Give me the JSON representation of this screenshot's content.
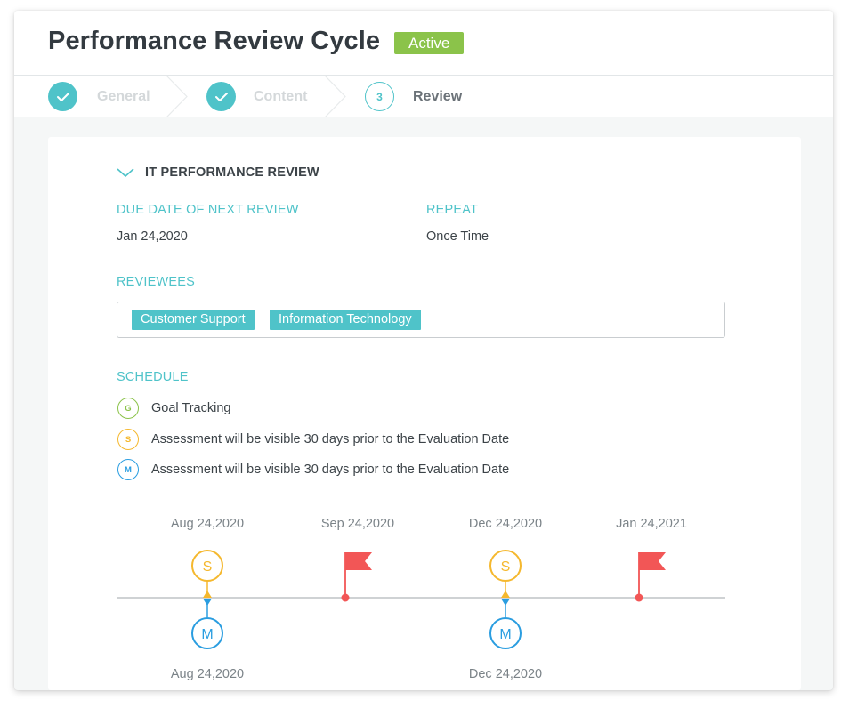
{
  "header": {
    "title": "Performance Review Cycle",
    "status_badge": "Active"
  },
  "steps": [
    {
      "label": "General",
      "state": "done"
    },
    {
      "label": "Content",
      "state": "done"
    },
    {
      "label": "Review",
      "state": "current",
      "number": "3"
    }
  ],
  "section": {
    "title": "IT PERFORMANCE REVIEW",
    "due_label": "DUE DATE OF NEXT REVIEW",
    "due_value": "Jan 24,2020",
    "repeat_label": "REPEAT",
    "repeat_value": "Once Time",
    "reviewees_label": "REVIEWEES",
    "reviewees": [
      "Customer Support",
      "Information Technology"
    ],
    "schedule_label": "SCHEDULE"
  },
  "legend": [
    {
      "letter": "G",
      "text": "Goal Tracking",
      "color": "#8bc34a"
    },
    {
      "letter": "S",
      "text": "Assessment will be visible 30 days prior to the Evaluation Date",
      "color": "#f5b82e"
    },
    {
      "letter": "M",
      "text": "Assessment will be visible 30 days prior to the Evaluation Date",
      "color": "#2a9de0"
    }
  ],
  "timeline": {
    "top_dates": [
      "Aug 24,2020",
      "Sep 24,2020",
      "Dec 24,2020",
      "Jan 24,2021"
    ],
    "bottom_dates": [
      "Aug 24,2020",
      "Dec 24,2020"
    ],
    "s_label": "S",
    "m_label": "M"
  },
  "colors": {
    "accent": "#4fc3c9",
    "active_badge": "#8bc34a",
    "flag": "#f25656",
    "s_marker": "#f5b82e",
    "m_marker": "#2a9de0"
  }
}
